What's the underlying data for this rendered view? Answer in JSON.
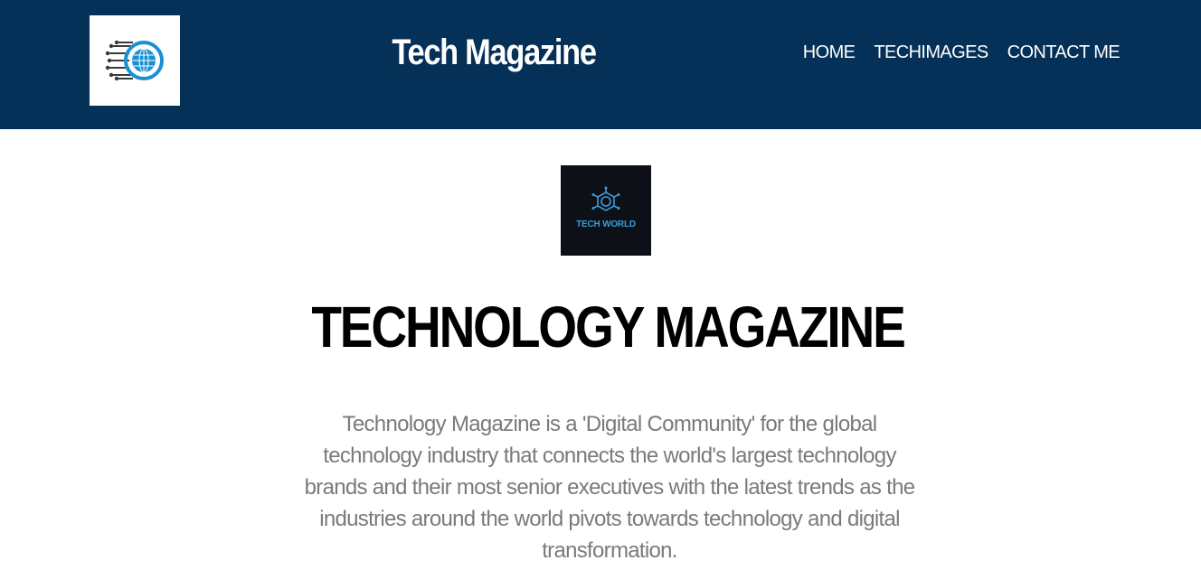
{
  "header": {
    "logo_icon": "globe-circuit-icon",
    "title": "Tech Magazine",
    "background_color": "#053057",
    "nav": [
      {
        "label": "HOME"
      },
      {
        "label": "TECHIMAGES"
      },
      {
        "label": "CONTACT ME"
      }
    ]
  },
  "hero": {
    "logo_icon": "tech-world-logo",
    "logo_text": "TECH WORLD",
    "title": "TECHNOLOGY MAGAZINE",
    "description": "Technology Magazine is a 'Digital Community' for the global technology industry that connects the world's largest technology brands and their most senior executives with the latest trends as the industries around the world pivots towards technology and digital transformation."
  }
}
